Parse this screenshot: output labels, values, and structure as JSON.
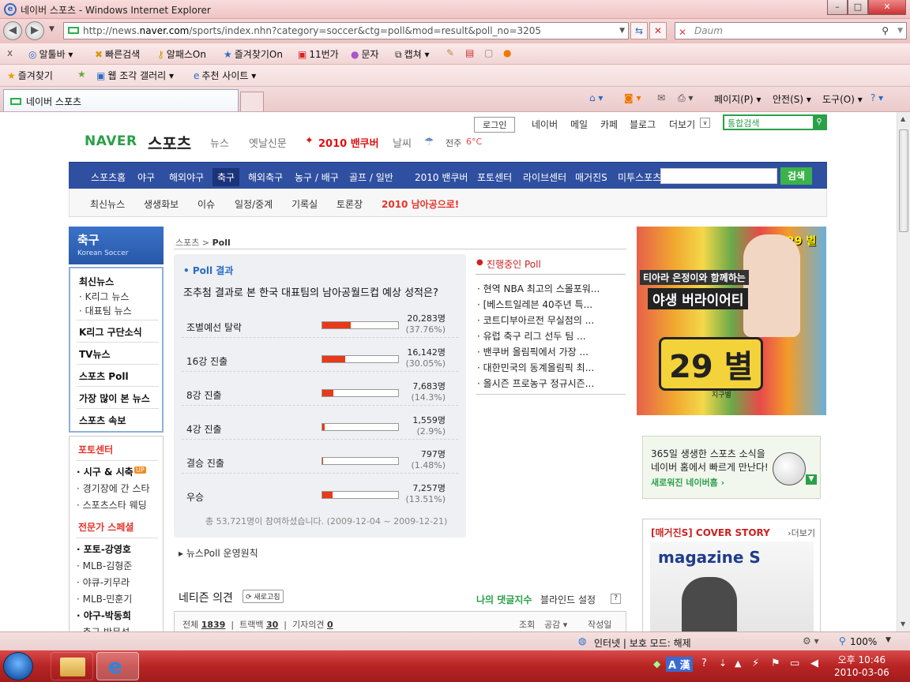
{
  "window": {
    "title": "네이버 스포츠 - Windows Internet Explorer",
    "minimize": "–",
    "maximize": "□",
    "close": "✕"
  },
  "address": {
    "prefix": "http://news.",
    "domain": "naver.com",
    "rest": "/sports/index.nhn?category=soccer&ctg=poll&mod=result&poll_no=3205",
    "search_placeholder": "Daum"
  },
  "toolbar": {
    "close": "x",
    "items": [
      "알툴바 ▾",
      "빠른검색",
      "알패스On",
      "즐겨찾기On",
      "11번가",
      "문자",
      "캡쳐 ▾"
    ]
  },
  "favbar": {
    "favorites": "즐겨찾기",
    "items": [
      "웹 조각 갤러리 ▾",
      "추천 사이트 ▾"
    ]
  },
  "tabs": {
    "active": "네이버 스포츠"
  },
  "commandbar": {
    "page": "페이지(P) ▾",
    "safety": "안전(S) ▾",
    "tools": "도구(O) ▾",
    "help": "? ▾"
  },
  "naver": {
    "top_links": {
      "login": "로그인",
      "items": [
        "네이버",
        "메일",
        "카페",
        "블로그",
        "더보기"
      ],
      "search_placeholder": "통합검색"
    },
    "brand": {
      "logo": "NAVER",
      "section": "스포츠",
      "links": [
        "뉴스",
        "옛날신문"
      ],
      "vancouver": "2010 밴쿠버",
      "weather": "날씨",
      "city": "전주",
      "temp": "6°C"
    },
    "gnb": [
      "스포츠홈",
      "야구",
      "해외야구",
      "축구",
      "해외축구",
      "농구 / 배구",
      "골프 / 일반",
      "2010 밴쿠버",
      "포토센터",
      "라이브센터",
      "매거진S",
      "미투스포츠"
    ],
    "gnb_search": "검색",
    "lnb": [
      "최신뉴스",
      "생생화보",
      "이슈",
      "일정/중계",
      "기록실",
      "토론장",
      "2010 남아공으로!"
    ],
    "left": {
      "title": "축구",
      "subtitle": "Korean Soccer",
      "menu": [
        {
          "label": "최신뉴스",
          "subs": [
            "· K리그 뉴스",
            "· 대표팀 뉴스"
          ]
        },
        {
          "label": "K리그 구단소식"
        },
        {
          "label": "TV뉴스"
        },
        {
          "label": "스포츠 Poll"
        },
        {
          "label": "가장 많이 본 뉴스"
        },
        {
          "label": "스포츠 속보"
        }
      ],
      "photo_center": "포토센터",
      "photo_items": [
        "· 시구 & 시축",
        "· 경기장에 간 스타",
        "· 스포츠스타 웨딩"
      ],
      "up": "UP",
      "expert": "전문가 스페셜",
      "expert_items": [
        "· 포토-강영호",
        "· MLB-김형준",
        "· 야큐-키무라",
        "· MLB-민훈기",
        "· 야구-박동희",
        "· 축구-박문성"
      ]
    },
    "breadcrumb": {
      "home": "스포츠",
      "sep": ">",
      "current": "Poll"
    },
    "poll": {
      "heading": "• Poll 결과",
      "question": "조추첨 결과로 본 한국 대표팀의 남아공월드컵 예상 성적은?",
      "options": [
        {
          "label": "조별예선 탈락",
          "count": "20,283명",
          "percent": "(37.76%)",
          "value": 37.76
        },
        {
          "label": "16강 진출",
          "count": "16,142명",
          "percent": "(30.05%)",
          "value": 30.05
        },
        {
          "label": "8강 진출",
          "count": "7,683명",
          "percent": "(14.3%)",
          "value": 14.3
        },
        {
          "label": "4강 진출",
          "count": "1,559명",
          "percent": "(2.9%)",
          "value": 2.9
        },
        {
          "label": "결승 진출",
          "count": "797명",
          "percent": "(1.48%)",
          "value": 1.48
        },
        {
          "label": "우승",
          "count": "7,257명",
          "percent": "(13.51%)",
          "value": 13.51
        }
      ],
      "total": "총 53,721명이 참여하셨습니다. (2009-12-04 ~ 2009-12-21)"
    },
    "rules": "뉴스Poll 운영원칙",
    "ongoing": {
      "title": "진행중인 Poll",
      "items": [
        "· 현역 NBA 최고의 스몰포워...",
        "· [베스트일레븐 40주년 특...",
        "· 코트디부아르전 무실점의 ...",
        "· 유럽 축구 리그 선두 팀 ...",
        "· 밴쿠버 올림픽에서 가장 ...",
        "· 대한민국의 동계올림픽 최...",
        "· 올시즌 프로농구 정규시즌..."
      ]
    },
    "comments": {
      "title": "네티즌 의견",
      "refresh": "새로고침",
      "my": "나의 댓글지수",
      "blind": "블라인드 설정",
      "total_label": "전체",
      "total": "1839",
      "trackback_label": "트랙백",
      "trackback": "30",
      "reporter_label": "기자의견",
      "reporter": "0",
      "views": "조회",
      "likes": "공감 ▾",
      "author": "작성일"
    },
    "ad_main": {
      "badge": "29 별",
      "line1": "티아라 은정이와 함께하는",
      "line2": "야생 버라이어티",
      "big": "29 별",
      "sub": "지구별"
    },
    "ad_home": {
      "line1": "365일 생생한 스포츠 소식을",
      "line2": "네이버 홈에서 빠르게 만난다!",
      "link": "새로워진 네이버홈 ›"
    },
    "cover": {
      "title": "[매거진S] COVER STORY",
      "more": "›더보기",
      "logo": "magazine S"
    }
  },
  "status": {
    "zone": "인터넷 | 보호 모드: 해제",
    "zoom": "100%"
  },
  "taskbar": {
    "time": "오후 10:46",
    "date": "2010-03-06",
    "ime": "A 漢"
  },
  "colors": {
    "accent": "#2f4fa0",
    "poll_bar": "#e63a1a",
    "naver_green": "#2aa048",
    "titlebar": "#efc4c4"
  }
}
